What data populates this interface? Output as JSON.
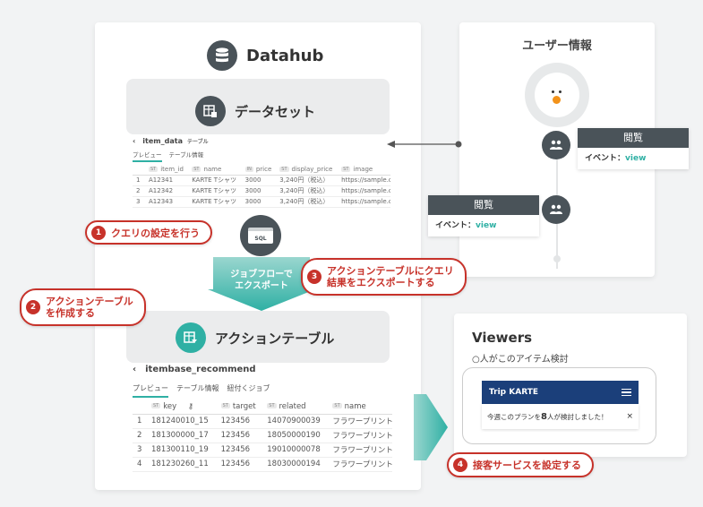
{
  "datahub": {
    "title": "Datahub",
    "dataset": {
      "title": "データセット",
      "table_name": "item_data",
      "table_tag": "テーブル",
      "tabs": [
        "プレビュー",
        "テーブル情報"
      ],
      "columns": [
        "item_id",
        "name",
        "price",
        "display_price",
        "image"
      ],
      "rows": [
        [
          "1",
          "A12341",
          "KARTE Tシャツ",
          "3000",
          "3,240円（税込）",
          "https://sample.co"
        ],
        [
          "2",
          "A12342",
          "KARTE Tシャツ",
          "3000",
          "3,240円（税込）",
          "https://sample.co"
        ],
        [
          "3",
          "A12343",
          "KARTE Tシャツ",
          "3000",
          "3,240円（税込）",
          "https://sample.co"
        ]
      ]
    },
    "sql_label": "SQL",
    "export_label_line1": "ジョブフローで",
    "export_label_line2": "エクスポート",
    "action_table": {
      "title": "アクションテーブル",
      "table_name": "itembase_recommend",
      "tabs": [
        "プレビュー",
        "テーブル情報",
        "紐付くジョブ"
      ],
      "columns": [
        "key",
        "target",
        "related",
        "name"
      ],
      "rows": [
        [
          "1",
          "181240010_15",
          "123456",
          "14070900039",
          "フラワープリント"
        ],
        [
          "2",
          "181300000_17",
          "123456",
          "18050000190",
          "フラワープリント"
        ],
        [
          "3",
          "181300110_19",
          "123456",
          "19010000078",
          "フラワープリント"
        ],
        [
          "4",
          "181230260_11",
          "123456",
          "18030000194",
          "フラワープリント"
        ]
      ]
    }
  },
  "user_info": {
    "title": "ユーザー情報",
    "events": [
      {
        "label": "閲覧",
        "event_prefix": "イベント：",
        "event_value": "view"
      },
      {
        "label": "閲覧",
        "event_prefix": "イベント：",
        "event_value": "view"
      }
    ]
  },
  "viewers": {
    "title": "Viewers",
    "subtitle": "○人がこのアイテム検討",
    "brand": "Trip KARTE",
    "message_before": "今週このプランを",
    "message_count": "8",
    "message_after": "人が検討しました！",
    "close": "×"
  },
  "callouts": {
    "c1": {
      "num": "1",
      "text": "クエリの設定を行う"
    },
    "c2": {
      "num": "2",
      "line1": "アクションテーブル",
      "line2": "を作成する"
    },
    "c3": {
      "num": "3",
      "line1": "アクションテーブルにクエリ",
      "line2": "結果をエクスポートする"
    },
    "c4": {
      "num": "4",
      "text": "接客サービスを設定する"
    }
  },
  "colors": {
    "teal": "#2fb0a4",
    "dark": "#4a5359",
    "red": "#c7322a",
    "navy": "#1b3f7a"
  }
}
